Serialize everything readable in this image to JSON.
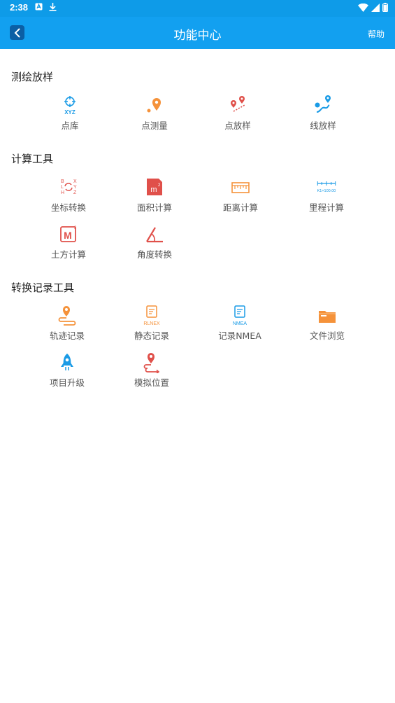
{
  "status_bar": {
    "time": "2:38"
  },
  "header": {
    "title": "功能中心",
    "help_label": "帮助"
  },
  "sections": [
    {
      "title": "测绘放样",
      "items": [
        {
          "label": "点库",
          "icon": "crosshair-xyz-icon"
        },
        {
          "label": "点测量",
          "icon": "map-pin-point-icon"
        },
        {
          "label": "点放样",
          "icon": "point-stakeout-icon"
        },
        {
          "label": "线放样",
          "icon": "line-stakeout-icon"
        }
      ]
    },
    {
      "title": "计算工具",
      "items": [
        {
          "label": "坐标转换",
          "icon": "blh-xyz-convert-icon"
        },
        {
          "label": "面积计算",
          "icon": "area-m2-icon"
        },
        {
          "label": "距离计算",
          "icon": "ruler-icon"
        },
        {
          "label": "里程计算",
          "icon": "mileage-k1-icon",
          "icon_text": "K1+100.00"
        },
        {
          "label": "土方计算",
          "icon": "volume-m3-icon"
        },
        {
          "label": "角度转换",
          "icon": "angle-icon"
        }
      ]
    },
    {
      "title": "转换记录工具",
      "items": [
        {
          "label": "轨迹记录",
          "icon": "track-record-icon"
        },
        {
          "label": "静态记录",
          "icon": "static-record-icon",
          "icon_text": "RLNEX"
        },
        {
          "label": "记录NMEA",
          "icon": "nmea-record-icon",
          "icon_text": "NMEA"
        },
        {
          "label": "文件浏览",
          "icon": "folder-icon"
        },
        {
          "label": "项目升级",
          "icon": "rocket-icon"
        },
        {
          "label": "模拟位置",
          "icon": "simulate-location-icon"
        }
      ]
    }
  ],
  "colors": {
    "app_bar": "#12a0f0",
    "blue_icon": "#1a9be6",
    "red_icon": "#e0504a",
    "orange_icon": "#f5923a"
  }
}
